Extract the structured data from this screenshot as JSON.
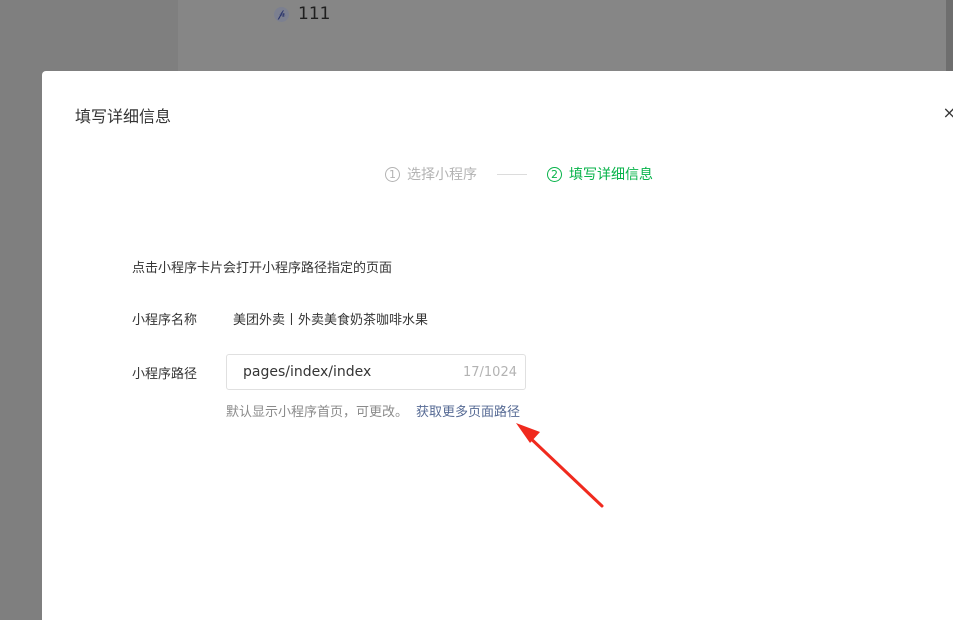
{
  "background": {
    "link_text": "111",
    "link_icon": "link-icon"
  },
  "dialog": {
    "title": "填写详细信息",
    "close_glyph": "X"
  },
  "steps": [
    {
      "num": "1",
      "label": "选择小程序",
      "state": "inactive"
    },
    {
      "num": "2",
      "label": "填写详细信息",
      "state": "active"
    }
  ],
  "form": {
    "hint": "点击小程序卡片会打开小程序路径指定的页面",
    "name_label": "小程序名称",
    "name_value": "美团外卖丨外卖美食奶茶咖啡水果",
    "path_label": "小程序路径",
    "path_value": "pages/index/index",
    "path_counter": "17/1024",
    "path_tip": "默认显示小程序首页，可更改。",
    "path_link": "获取更多页面路径"
  },
  "colors": {
    "accent_green": "#07b34a",
    "link_blue": "#576b95",
    "annotation_red": "#f02a1e"
  }
}
